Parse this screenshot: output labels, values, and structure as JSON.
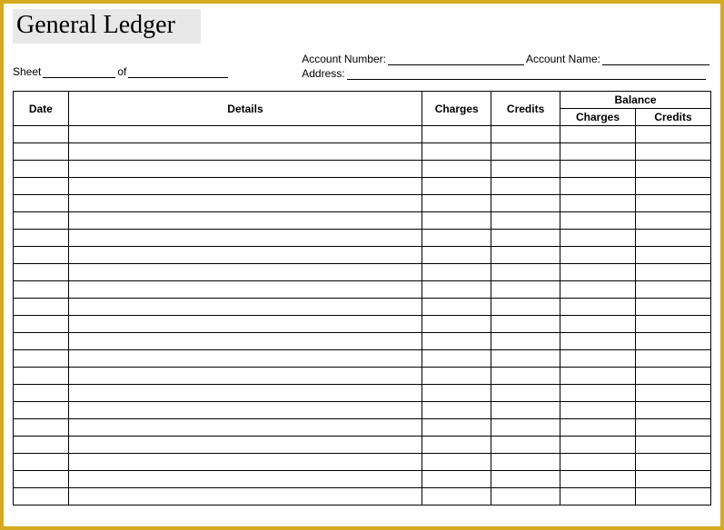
{
  "title": "General Ledger",
  "header": {
    "sheet_label": "Sheet",
    "of_label": "of",
    "sheet_value": "",
    "sheet_of_value": "",
    "account_number_label": "Account Number:",
    "account_number_value": "",
    "account_name_label": "Account Name:",
    "account_name_value": "",
    "address_label": "Address:",
    "address_value": ""
  },
  "columns": {
    "date": "Date",
    "details": "Details",
    "charges": "Charges",
    "credits": "Credits",
    "balance": "Balance",
    "balance_charges": "Charges",
    "balance_credits": "Credits"
  },
  "rows": [
    {
      "date": "",
      "details": "",
      "charges": "",
      "credits": "",
      "bal_charges": "",
      "bal_credits": ""
    },
    {
      "date": "",
      "details": "",
      "charges": "",
      "credits": "",
      "bal_charges": "",
      "bal_credits": ""
    },
    {
      "date": "",
      "details": "",
      "charges": "",
      "credits": "",
      "bal_charges": "",
      "bal_credits": ""
    },
    {
      "date": "",
      "details": "",
      "charges": "",
      "credits": "",
      "bal_charges": "",
      "bal_credits": ""
    },
    {
      "date": "",
      "details": "",
      "charges": "",
      "credits": "",
      "bal_charges": "",
      "bal_credits": ""
    },
    {
      "date": "",
      "details": "",
      "charges": "",
      "credits": "",
      "bal_charges": "",
      "bal_credits": ""
    },
    {
      "date": "",
      "details": "",
      "charges": "",
      "credits": "",
      "bal_charges": "",
      "bal_credits": ""
    },
    {
      "date": "",
      "details": "",
      "charges": "",
      "credits": "",
      "bal_charges": "",
      "bal_credits": ""
    },
    {
      "date": "",
      "details": "",
      "charges": "",
      "credits": "",
      "bal_charges": "",
      "bal_credits": ""
    },
    {
      "date": "",
      "details": "",
      "charges": "",
      "credits": "",
      "bal_charges": "",
      "bal_credits": ""
    },
    {
      "date": "",
      "details": "",
      "charges": "",
      "credits": "",
      "bal_charges": "",
      "bal_credits": ""
    },
    {
      "date": "",
      "details": "",
      "charges": "",
      "credits": "",
      "bal_charges": "",
      "bal_credits": ""
    },
    {
      "date": "",
      "details": "",
      "charges": "",
      "credits": "",
      "bal_charges": "",
      "bal_credits": ""
    },
    {
      "date": "",
      "details": "",
      "charges": "",
      "credits": "",
      "bal_charges": "",
      "bal_credits": ""
    },
    {
      "date": "",
      "details": "",
      "charges": "",
      "credits": "",
      "bal_charges": "",
      "bal_credits": ""
    },
    {
      "date": "",
      "details": "",
      "charges": "",
      "credits": "",
      "bal_charges": "",
      "bal_credits": ""
    },
    {
      "date": "",
      "details": "",
      "charges": "",
      "credits": "",
      "bal_charges": "",
      "bal_credits": ""
    },
    {
      "date": "",
      "details": "",
      "charges": "",
      "credits": "",
      "bal_charges": "",
      "bal_credits": ""
    },
    {
      "date": "",
      "details": "",
      "charges": "",
      "credits": "",
      "bal_charges": "",
      "bal_credits": ""
    },
    {
      "date": "",
      "details": "",
      "charges": "",
      "credits": "",
      "bal_charges": "",
      "bal_credits": ""
    },
    {
      "date": "",
      "details": "",
      "charges": "",
      "credits": "",
      "bal_charges": "",
      "bal_credits": ""
    },
    {
      "date": "",
      "details": "",
      "charges": "",
      "credits": "",
      "bal_charges": "",
      "bal_credits": ""
    }
  ]
}
